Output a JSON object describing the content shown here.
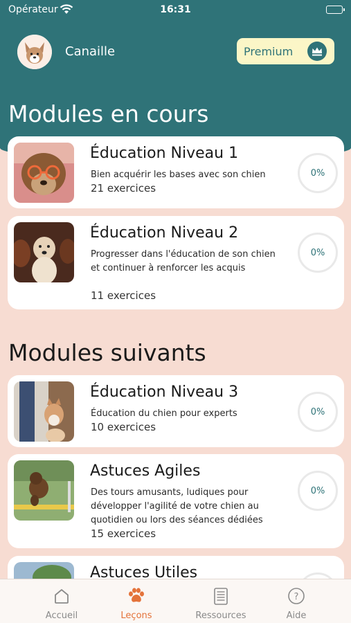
{
  "status_bar": {
    "carrier": "Opérateur",
    "time": "16:31"
  },
  "header": {
    "username": "Canaille",
    "premium_label": "Premium"
  },
  "sections": {
    "current_title": "Modules en cours",
    "next_title": "Modules suivants"
  },
  "modules": [
    {
      "title": "Éducation Niveau 1",
      "description": "Bien acquérir les bases avec son chien",
      "count": "21 exercices",
      "progress": "0%"
    },
    {
      "title": "Éducation Niveau 2",
      "description": "Progresser dans l'éducation de son chien et continuer à renforcer les acquis",
      "count": "11 exercices",
      "progress": "0%"
    },
    {
      "title": "Éducation Niveau 3",
      "description": "Éducation du chien pour experts",
      "count": "10 exercices",
      "progress": "0%"
    },
    {
      "title": "Astuces Agiles",
      "description": "Des tours amusants, ludiques pour développer l'agilité de votre chien au quotidien ou lors des séances dédiées",
      "count": "15 exercices",
      "progress": "0%"
    },
    {
      "title": "Astuces Utiles"
    }
  ],
  "tabbar": [
    {
      "label": "Accueil",
      "icon": "home-icon"
    },
    {
      "label": "Leçons",
      "icon": "paw-icon",
      "active": true
    },
    {
      "label": "Ressources",
      "icon": "document-icon"
    },
    {
      "label": "Aide",
      "icon": "help-icon"
    }
  ],
  "colors": {
    "header_bg": "#2f7378",
    "page_bg": "#f7dcd2",
    "accent": "#e4733a",
    "premium_bg": "#fbf6c7"
  }
}
